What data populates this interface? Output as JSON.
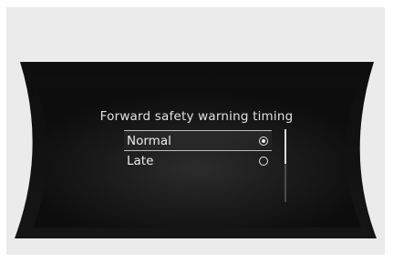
{
  "screen": {
    "title": "Forward safety warning timing",
    "options": [
      {
        "label": "Normal",
        "selected": true
      },
      {
        "label": "Late",
        "selected": false
      }
    ],
    "scroll_position_fraction": 0.0,
    "scroll_visible_fraction": 0.48
  },
  "colors": {
    "display_background": "#121212",
    "frame": "#ebebeb",
    "text": "#e2e2e2"
  }
}
